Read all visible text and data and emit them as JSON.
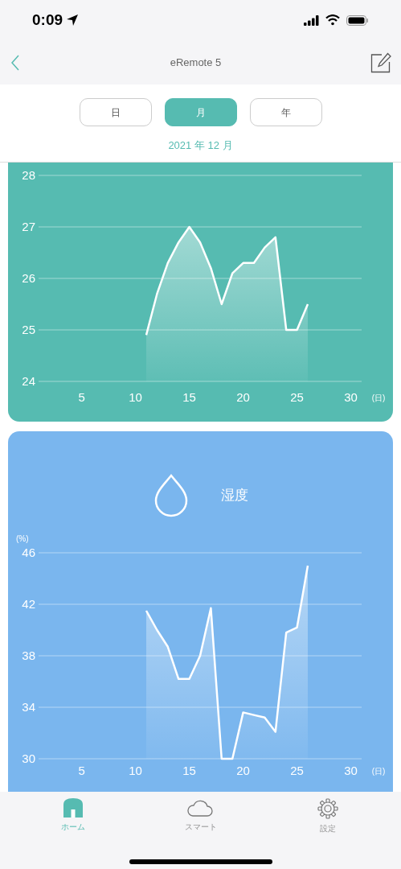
{
  "status_bar": {
    "time": "0:09"
  },
  "nav": {
    "title": "eRemote 5"
  },
  "segments": [
    {
      "label": "日",
      "selected": false
    },
    {
      "label": "月",
      "selected": true
    },
    {
      "label": "年",
      "selected": false
    }
  ],
  "period": "2021 年 12 月",
  "cards": [
    {
      "kind": "temperature",
      "color": "#56bbb1",
      "chart_data": {
        "type": "area",
        "xlabel": "(日)",
        "x": [
          11,
          12,
          13,
          14,
          15,
          16,
          17,
          18,
          19,
          20,
          21,
          22,
          23,
          24,
          25,
          26
        ],
        "series": [
          {
            "color": "#ffffff",
            "values": [
              24.9,
              25.7,
              26.3,
              26.7,
              27.0,
              26.7,
              26.2,
              25.5,
              26.1,
              26.3,
              26.3,
              26.6,
              26.8,
              25.0,
              25.0,
              25.5
            ]
          }
        ],
        "grid": true,
        "xlim": [
          1,
          31
        ],
        "ylim": [
          24,
          28
        ],
        "xticks": [
          5,
          10,
          15,
          20,
          25,
          30
        ],
        "yticks": [
          24,
          25,
          26,
          27,
          28
        ]
      }
    },
    {
      "kind": "humidity",
      "color": "#7ab6ee",
      "title": "湿度",
      "chart_data": {
        "type": "area",
        "xlabel": "(日)",
        "ylabel": "(%)",
        "x": [
          11,
          12,
          13,
          14,
          15,
          16,
          17,
          18,
          19,
          20,
          21,
          22,
          23,
          24,
          25,
          26
        ],
        "series": [
          {
            "color": "#ffffff",
            "values": [
              41.5,
              40.0,
              38.7,
              36.2,
              36.2,
              38.0,
              41.7,
              30.0,
              30.0,
              33.6,
              33.4,
              33.2,
              32.1,
              39.8,
              40.2,
              45.0
            ]
          }
        ],
        "grid": true,
        "xlim": [
          1,
          31
        ],
        "ylim": [
          30,
          46
        ],
        "xticks": [
          5,
          10,
          15,
          20,
          25,
          30
        ],
        "yticks": [
          30,
          34,
          38,
          42,
          46
        ]
      }
    }
  ],
  "tab_bar": [
    {
      "label": "ホーム",
      "kind": "home",
      "selected": true
    },
    {
      "label": "スマート",
      "kind": "cloud",
      "selected": false
    },
    {
      "label": "設定",
      "kind": "settings",
      "selected": false
    }
  ]
}
